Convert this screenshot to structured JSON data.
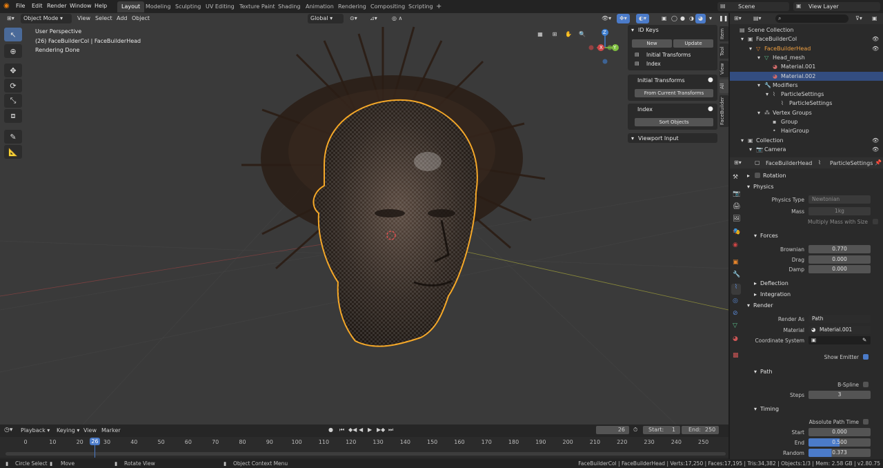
{
  "menus": [
    "File",
    "Edit",
    "Render",
    "Window",
    "Help"
  ],
  "workspaces": [
    "Layout",
    "Modeling",
    "Sculpting",
    "UV Editing",
    "Texture Paint",
    "Shading",
    "Animation",
    "Rendering",
    "Compositing",
    "Scripting"
  ],
  "active_workspace": "Layout",
  "add_tab": "+",
  "scene": {
    "name": "Scene",
    "view_layer": "View Layer"
  },
  "viewport_header": {
    "mode": "Object Mode",
    "view": "View",
    "select": "Select",
    "add": "Add",
    "object": "Object",
    "orientation": "Global"
  },
  "viewport_info": {
    "perspective": "User Perspective",
    "collection": "(26) FaceBuilderCol | FaceBuilderHead",
    "status": "Rendering Done"
  },
  "gizmo": {
    "z": "Z",
    "x": "X",
    "y": "Y"
  },
  "npanel": {
    "tabs": [
      "Item",
      "Tool",
      "View",
      "All",
      "FaceBuilder"
    ],
    "id_keys": {
      "title": "ID Keys",
      "new": "New",
      "update": "Update",
      "items": [
        "Initial Transforms",
        "Index"
      ]
    },
    "initial_transforms": {
      "title": "Initial Transforms",
      "button": "From Current Transforms"
    },
    "index": {
      "title": "Index",
      "button": "Sort Objects"
    },
    "viewport_input": "Viewport Input"
  },
  "outliner": {
    "rows": [
      {
        "label": "Scene Collection",
        "indent": 0
      },
      {
        "label": "FaceBuilderCol",
        "indent": 1
      },
      {
        "label": "FaceBuilderHead",
        "indent": 2
      },
      {
        "label": "Head_mesh",
        "indent": 3
      },
      {
        "label": "Material.001",
        "indent": 4
      },
      {
        "label": "Material.002",
        "indent": 4
      },
      {
        "label": "Modifiers",
        "indent": 3
      },
      {
        "label": "ParticleSettings",
        "indent": 4
      },
      {
        "label": "ParticleSettings",
        "indent": 5
      },
      {
        "label": "Vertex Groups",
        "indent": 3
      },
      {
        "label": "Group",
        "indent": 4
      },
      {
        "label": "HairGroup",
        "indent": 4
      },
      {
        "label": "Collection",
        "indent": 1
      },
      {
        "label": "Camera",
        "indent": 2
      }
    ]
  },
  "properties": {
    "breadcrumb": [
      "FaceBuilderHead",
      "ParticleSettings"
    ],
    "rotation": "Rotation",
    "physics": {
      "title": "Physics",
      "physics_type_label": "Physics Type",
      "physics_type": "Newtonian",
      "mass_label": "Mass",
      "mass": "1kg",
      "multiply_mass": "Multiply Mass with Size",
      "forces": "Forces",
      "brownian_label": "Brownian",
      "brownian": "0.770",
      "drag_label": "Drag",
      "drag": "0.000",
      "damp_label": "Damp",
      "damp": "0.000",
      "deflection": "Deflection",
      "integration": "Integration"
    },
    "render": {
      "title": "Render",
      "render_as_label": "Render As",
      "render_as": "Path",
      "material_label": "Material",
      "material": "Material.001",
      "coord_label": "Coordinate System",
      "show_emitter": "Show Emitter",
      "path": "Path",
      "bspline": "B-Spline",
      "steps_label": "Steps",
      "steps": "3",
      "timing": "Timing",
      "absolute_path_time": "Absolute Path Time",
      "start_label": "Start",
      "start": "0.000",
      "end_label": "End",
      "end": "0.500",
      "end_fraction": 0.5,
      "random_label": "Random",
      "random": "0.373",
      "random_fraction": 0.373
    }
  },
  "timeline": {
    "playback": "Playback",
    "keying": "Keying",
    "view": "View",
    "marker": "Marker",
    "current_frame": "26",
    "start_label": "Start:",
    "start": "1",
    "end_label": "End:",
    "end": "250",
    "ticks": [
      "0",
      "10",
      "20",
      "26",
      "30",
      "40",
      "50",
      "60",
      "70",
      "80",
      "90",
      "100",
      "110",
      "120",
      "130",
      "140",
      "150",
      "160",
      "170",
      "180",
      "190",
      "200",
      "210",
      "220",
      "230",
      "240",
      "250"
    ]
  },
  "statusbar": {
    "circle_select": "Circle Select",
    "move": "Move",
    "rotate_view": "Rotate View",
    "context_menu": "Object Context Menu",
    "stats": "FaceBuilderCol | FaceBuilderHead | Verts:17,250 | Faces:17,195 | Tris:34,382 | Objects:1/3 | Mem: 2.58 GB | v2.80.75"
  },
  "colors": {
    "accent": "#4b7bc9",
    "selection_outline": "#f5a623",
    "selected_row": "#334d80"
  }
}
